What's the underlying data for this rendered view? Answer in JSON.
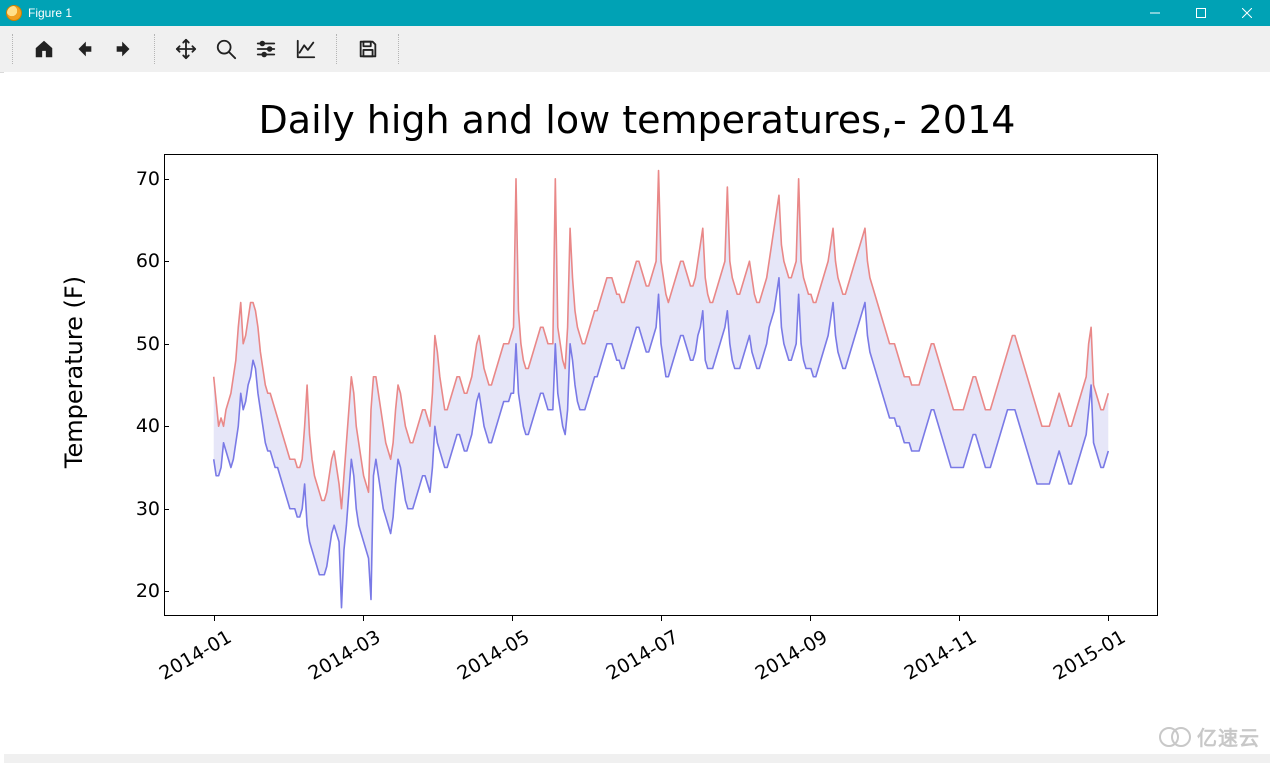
{
  "window": {
    "title": "Figure 1"
  },
  "toolbar": {
    "home": "Home",
    "back": "Back",
    "forward": "Forward",
    "pan": "Pan",
    "zoom": "Zoom",
    "subplots": "Configure subplots",
    "axes": "Edit axis",
    "save": "Save"
  },
  "watermark": "亿速云",
  "chart_data": {
    "type": "line",
    "title": "Daily high and low temperatures,- 2014",
    "xlabel": "",
    "ylabel": "Temperature (F)",
    "ylim": [
      17,
      73
    ],
    "x_ticks": [
      "2014-01",
      "2014-03",
      "2014-05",
      "2014-07",
      "2014-09",
      "2014-11",
      "2015-01"
    ],
    "y_ticks": [
      20,
      30,
      40,
      50,
      60,
      70
    ],
    "fill_between": {
      "upper": "high",
      "lower": "low",
      "color": "#c8c8f0",
      "alpha": 0.45
    },
    "series": [
      {
        "name": "high",
        "color": "#e98888",
        "values": [
          46,
          43,
          40,
          41,
          40,
          42,
          43,
          44,
          46,
          48,
          52,
          55,
          50,
          51,
          53,
          55,
          55,
          54,
          52,
          49,
          47,
          45,
          44,
          44,
          43,
          42,
          41,
          40,
          39,
          38,
          37,
          36,
          36,
          36,
          35,
          35,
          36,
          40,
          45,
          39,
          36,
          34,
          33,
          32,
          31,
          31,
          32,
          34,
          36,
          37,
          35,
          33,
          30,
          34,
          38,
          42,
          46,
          44,
          40,
          38,
          36,
          34,
          33,
          32,
          42,
          46,
          46,
          44,
          42,
          40,
          38,
          37,
          36,
          38,
          42,
          45,
          44,
          42,
          40,
          39,
          38,
          38,
          39,
          40,
          41,
          42,
          42,
          41,
          40,
          44,
          51,
          49,
          46,
          44,
          42,
          42,
          43,
          44,
          45,
          46,
          46,
          45,
          44,
          44,
          45,
          46,
          48,
          50,
          51,
          49,
          47,
          46,
          45,
          45,
          46,
          47,
          48,
          49,
          50,
          50,
          50,
          51,
          52,
          70,
          54,
          50,
          48,
          47,
          47,
          48,
          49,
          50,
          51,
          52,
          52,
          51,
          50,
          50,
          50,
          70,
          52,
          50,
          48,
          47,
          52,
          64,
          58,
          54,
          52,
          51,
          50,
          50,
          51,
          52,
          53,
          54,
          54,
          55,
          56,
          57,
          58,
          58,
          58,
          57,
          56,
          56,
          55,
          55,
          56,
          57,
          58,
          59,
          60,
          60,
          59,
          58,
          57,
          57,
          58,
          59,
          60,
          71,
          60,
          58,
          56,
          55,
          56,
          57,
          58,
          59,
          60,
          60,
          59,
          58,
          57,
          57,
          58,
          60,
          62,
          64,
          58,
          56,
          55,
          55,
          56,
          57,
          58,
          59,
          60,
          69,
          60,
          58,
          57,
          56,
          56,
          57,
          58,
          59,
          60,
          58,
          56,
          55,
          55,
          56,
          57,
          58,
          60,
          62,
          64,
          66,
          68,
          62,
          60,
          59,
          58,
          58,
          59,
          60,
          70,
          60,
          58,
          57,
          56,
          56,
          55,
          55,
          56,
          57,
          58,
          59,
          60,
          62,
          64,
          60,
          58,
          57,
          56,
          56,
          57,
          58,
          59,
          60,
          61,
          62,
          63,
          64,
          60,
          58,
          57,
          56,
          55,
          54,
          53,
          52,
          51,
          50,
          50,
          50,
          49,
          48,
          47,
          46,
          46,
          46,
          45,
          45,
          45,
          45,
          46,
          47,
          48,
          49,
          50,
          50,
          49,
          48,
          47,
          46,
          45,
          44,
          43,
          42,
          42,
          42,
          42,
          42,
          43,
          44,
          45,
          46,
          46,
          45,
          44,
          43,
          42,
          42,
          42,
          43,
          44,
          45,
          46,
          47,
          48,
          49,
          50,
          51,
          51,
          50,
          49,
          48,
          47,
          46,
          45,
          44,
          43,
          42,
          41,
          40,
          40,
          40,
          40,
          41,
          42,
          43,
          44,
          43,
          42,
          41,
          40,
          40,
          41,
          42,
          43,
          44,
          45,
          46,
          50,
          52,
          45,
          44,
          43,
          42,
          42,
          43,
          44
        ]
      },
      {
        "name": "low",
        "color": "#7a7ae6",
        "values": [
          36,
          34,
          34,
          35,
          38,
          37,
          36,
          35,
          36,
          38,
          40,
          44,
          42,
          43,
          45,
          46,
          48,
          47,
          44,
          42,
          40,
          38,
          37,
          37,
          36,
          35,
          35,
          34,
          33,
          32,
          31,
          30,
          30,
          30,
          29,
          29,
          30,
          33,
          28,
          26,
          25,
          24,
          23,
          22,
          22,
          22,
          23,
          25,
          27,
          28,
          27,
          26,
          18,
          25,
          28,
          32,
          36,
          34,
          30,
          28,
          27,
          26,
          25,
          24,
          19,
          34,
          36,
          34,
          32,
          30,
          29,
          28,
          27,
          29,
          33,
          36,
          35,
          33,
          31,
          30,
          30,
          30,
          31,
          32,
          33,
          34,
          34,
          33,
          32,
          35,
          40,
          38,
          37,
          36,
          35,
          35,
          36,
          37,
          38,
          39,
          39,
          38,
          37,
          37,
          38,
          39,
          41,
          43,
          44,
          42,
          40,
          39,
          38,
          38,
          39,
          40,
          41,
          42,
          43,
          43,
          43,
          44,
          44,
          50,
          44,
          42,
          40,
          39,
          39,
          40,
          41,
          42,
          43,
          44,
          44,
          43,
          42,
          42,
          42,
          50,
          44,
          42,
          40,
          39,
          42,
          50,
          48,
          45,
          43,
          42,
          42,
          42,
          43,
          44,
          45,
          46,
          46,
          47,
          48,
          49,
          50,
          50,
          50,
          49,
          48,
          48,
          47,
          47,
          48,
          49,
          50,
          51,
          52,
          52,
          51,
          50,
          49,
          49,
          50,
          51,
          52,
          56,
          50,
          48,
          46,
          46,
          47,
          48,
          49,
          50,
          51,
          51,
          50,
          49,
          48,
          48,
          49,
          51,
          52,
          54,
          48,
          47,
          47,
          47,
          48,
          49,
          50,
          51,
          52,
          54,
          50,
          48,
          47,
          47,
          47,
          48,
          49,
          50,
          51,
          49,
          48,
          47,
          47,
          48,
          49,
          50,
          52,
          53,
          54,
          56,
          58,
          52,
          50,
          49,
          48,
          48,
          49,
          50,
          56,
          50,
          48,
          47,
          47,
          47,
          46,
          46,
          47,
          48,
          49,
          50,
          51,
          53,
          55,
          51,
          49,
          48,
          47,
          47,
          48,
          49,
          50,
          51,
          52,
          53,
          54,
          55,
          51,
          49,
          48,
          47,
          46,
          45,
          44,
          43,
          42,
          41,
          41,
          41,
          40,
          40,
          39,
          38,
          38,
          38,
          37,
          37,
          37,
          37,
          38,
          39,
          40,
          41,
          42,
          42,
          41,
          40,
          39,
          38,
          37,
          36,
          35,
          35,
          35,
          35,
          35,
          35,
          36,
          37,
          38,
          39,
          39,
          38,
          37,
          36,
          35,
          35,
          35,
          36,
          37,
          38,
          39,
          40,
          41,
          42,
          42,
          42,
          42,
          41,
          40,
          39,
          38,
          37,
          36,
          35,
          34,
          33,
          33,
          33,
          33,
          33,
          33,
          34,
          35,
          36,
          37,
          36,
          35,
          34,
          33,
          33,
          34,
          35,
          36,
          37,
          38,
          39,
          42,
          45,
          38,
          37,
          36,
          35,
          35,
          36,
          37
        ]
      }
    ]
  }
}
